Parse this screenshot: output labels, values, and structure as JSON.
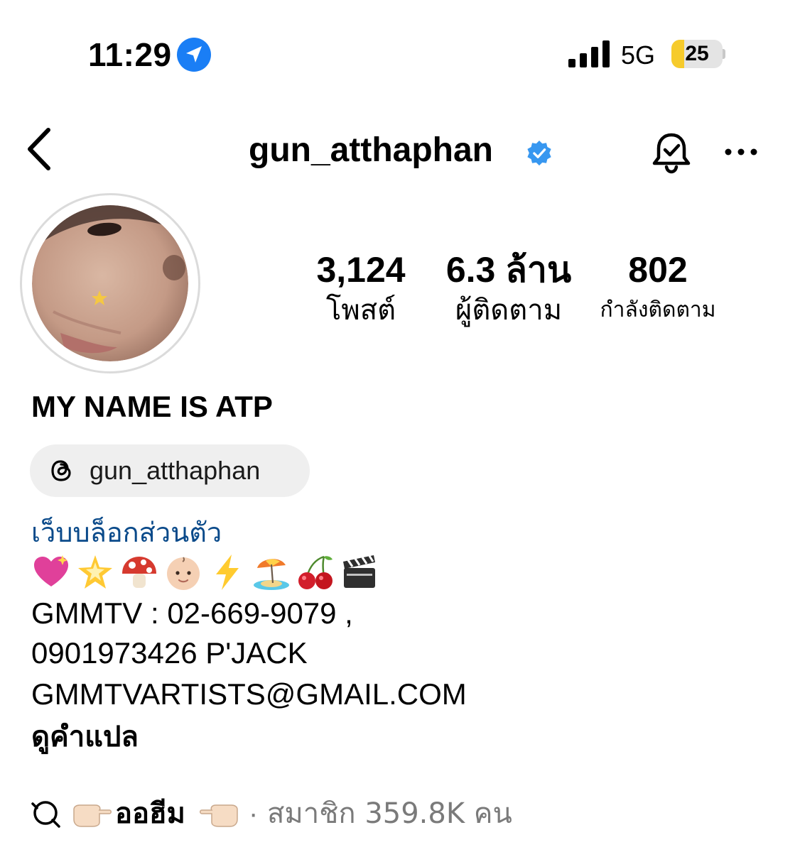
{
  "status_bar": {
    "time": "11:29",
    "network": "5G",
    "battery_level": "25",
    "battery_fraction": 0.25,
    "location_icon": "location-arrow-icon",
    "signal_icon": "signal-bars-icon"
  },
  "nav": {
    "username": "gun_atthaphan",
    "verified": true,
    "back_icon": "chevron-left-icon",
    "notification_icon": "bell-check-icon",
    "more_icon": "more-horizontal-icon"
  },
  "stats": [
    {
      "value": "3,124",
      "label": "โพสต์"
    },
    {
      "value": "6.3 ล้าน",
      "label": "ผู้ติดตาม"
    },
    {
      "value": "802",
      "label": "กำลังติดตาม"
    }
  ],
  "profile": {
    "full_name": "MY NAME IS ATP",
    "threads_handle": "gun_atthaphan",
    "category": "เว็บบล็อกส่วนตัว",
    "emojis": [
      "sparkling-heart",
      "glowing-star",
      "mushroom",
      "baby-face",
      "high-voltage",
      "beach-umbrella",
      "cherries",
      "clapper-board"
    ],
    "bio_lines": [
      "GMMTV : 02-669-9079 ,",
      "0901973426 P'JACK",
      "GMMTVARTISTS@GMAIL.COM"
    ],
    "translate_label": "ดูคำแปล"
  },
  "channel": {
    "name": "ออฮีม",
    "separator": "·",
    "members": "สมาชิก 359.8K คน"
  },
  "colors": {
    "verified_blue": "#3797f0",
    "location_blue": "#1a7ef5",
    "battery_yellow": "#f6cb2c",
    "category_blue": "#0a4a8a",
    "chip_gray": "#efefef",
    "muted_gray": "#7a7a7a"
  }
}
